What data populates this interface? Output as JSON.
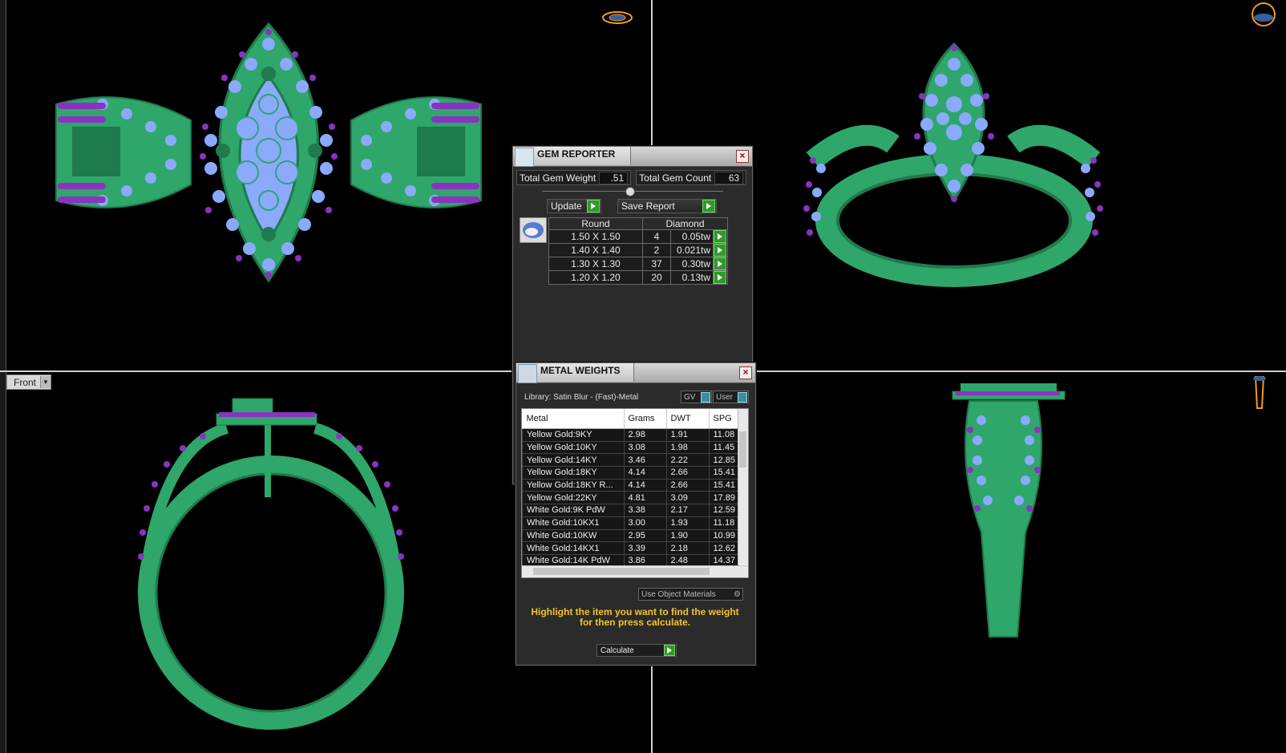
{
  "viewports": {
    "front_view_label": "Front"
  },
  "colors": {
    "metal": "#2fa66a",
    "metal_dark": "#1f7a4c",
    "diamond": "#8aa9ff",
    "prong": "#8a33c0",
    "accent_orange": "#f39a1e"
  },
  "gem_reporter": {
    "title": "GEM REPORTER",
    "total_weight_label": "Total Gem Weight",
    "total_weight_value": ".51",
    "total_count_label": "Total Gem Count",
    "total_count_value": "63",
    "update_label": "Update",
    "save_report_label": "Save Report",
    "shape_header": "Round",
    "type_header": "Diamond",
    "rows": [
      {
        "size": "1.50 X 1.50",
        "count": "4",
        "weight": "0.05tw"
      },
      {
        "size": "1.40 X 1.40",
        "count": "2",
        "weight": "0.021tw"
      },
      {
        "size": "1.30 X 1.30",
        "count": "37",
        "weight": "0.30tw"
      },
      {
        "size": "1.20 X 1.20",
        "count": "20",
        "weight": "0.13tw"
      }
    ]
  },
  "metal_weights": {
    "title": "METAL WEIGHTS",
    "library": "Library: Satin Blur - (Fast)-Metal",
    "gv_label": "GV",
    "user_label": "User",
    "headers": [
      "Metal",
      "Grams",
      "DWT",
      "SPG"
    ],
    "rows": [
      [
        "Yellow Gold:9KY",
        "2.98",
        "1.91",
        "11.08"
      ],
      [
        "Yellow Gold:10KY",
        "3.08",
        "1.98",
        "11.45"
      ],
      [
        "Yellow Gold:14KY",
        "3.46",
        "2.22",
        "12.85"
      ],
      [
        "Yellow Gold:18KY",
        "4.14",
        "2.66",
        "15.41"
      ],
      [
        "Yellow Gold:18KY R...",
        "4.14",
        "2.66",
        "15.41"
      ],
      [
        "Yellow Gold:22KY",
        "4.81",
        "3.09",
        "17.89"
      ],
      [
        "White Gold:9K PdW",
        "3.38",
        "2.17",
        "12.59"
      ],
      [
        "White Gold:10KX1",
        "3.00",
        "1.93",
        "11.18"
      ],
      [
        "White Gold:10KW",
        "2.95",
        "1.90",
        "10.99"
      ],
      [
        "White Gold:14KX1",
        "3.39",
        "2.18",
        "12.62"
      ],
      [
        "White Gold:14K PdW",
        "3.86",
        "2.48",
        "14.37"
      ]
    ],
    "use_object_materials": "Use Object Materials",
    "hint": "Highlight the item you want to find the weight for then press calculate.",
    "calculate_label": "Calculate"
  }
}
